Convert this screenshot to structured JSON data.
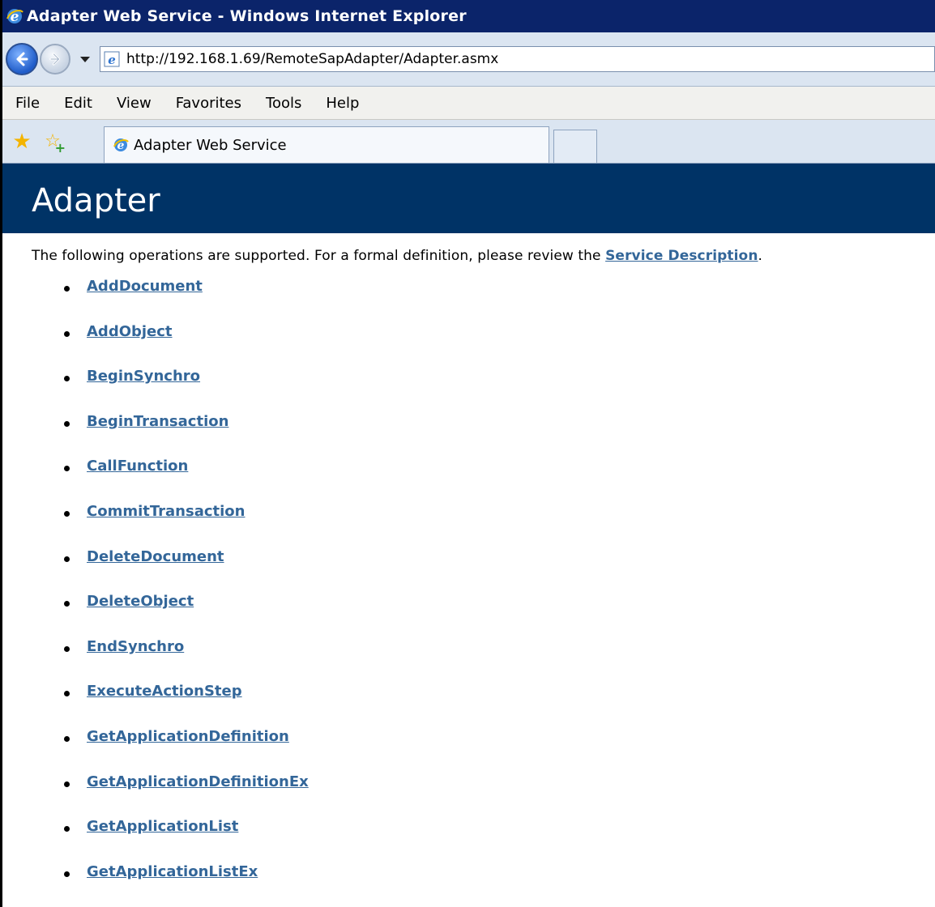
{
  "window": {
    "title": "Adapter Web Service - Windows Internet Explorer"
  },
  "navigation": {
    "address": "http://192.168.1.69/RemoteSapAdapter/Adapter.asmx"
  },
  "menu": {
    "items": [
      "File",
      "Edit",
      "View",
      "Favorites",
      "Tools",
      "Help"
    ]
  },
  "tabs": {
    "active_label": "Adapter Web Service"
  },
  "page": {
    "title": "Adapter",
    "intro_text": "The following operations are supported. For a formal definition, please review the ",
    "service_description_link": "Service Description",
    "intro_suffix": ".",
    "operations": [
      "AddDocument",
      "AddObject",
      "BeginSynchro",
      "BeginTransaction",
      "CallFunction",
      "CommitTransaction",
      "DeleteDocument",
      "DeleteObject",
      "EndSynchro",
      "ExecuteActionStep",
      "GetApplicationDefinition",
      "GetApplicationDefinitionEx",
      "GetApplicationList",
      "GetApplicationListEx"
    ]
  },
  "colors": {
    "titlebar": "#0b246a",
    "page_header": "#003366",
    "link": "#336699"
  },
  "icons": {
    "browser_logo": "ie-icon",
    "back": "back-arrow-icon",
    "forward": "forward-arrow-icon",
    "favorites": "favorites-star-icon",
    "add_favorites": "add-favorite-icon"
  }
}
